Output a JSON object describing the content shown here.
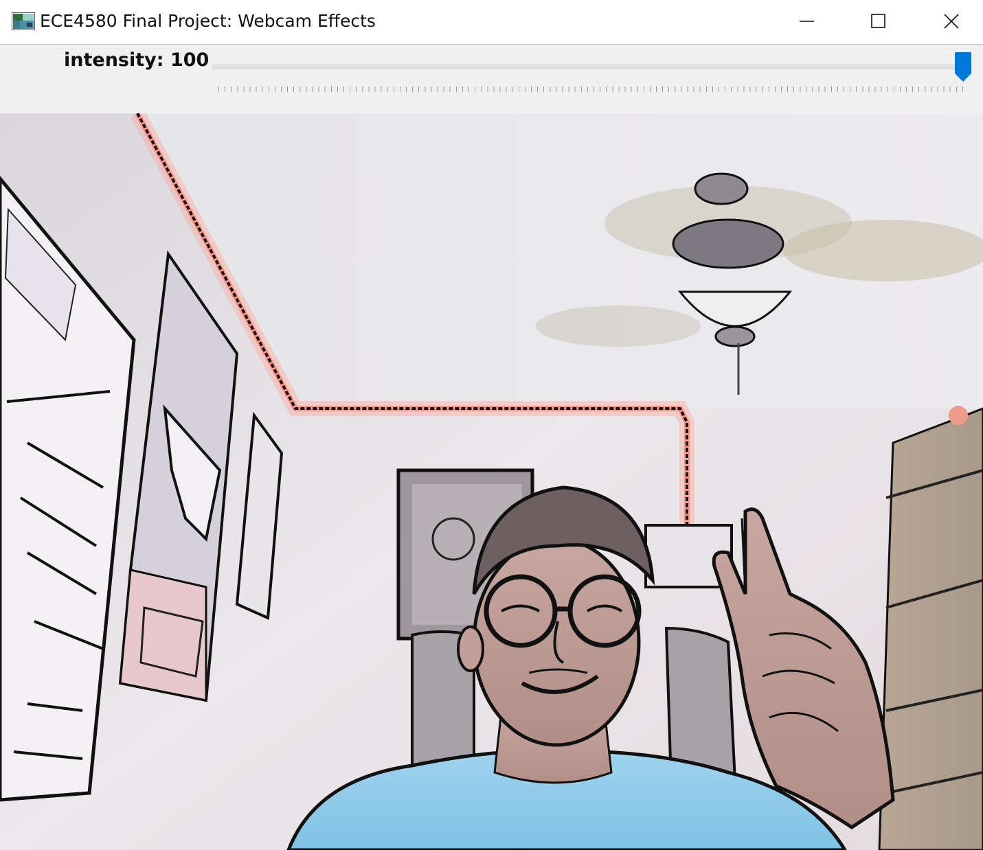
{
  "window": {
    "title": "ECE4580 Final Project: Webcam Effects",
    "icon": "window-app-icon",
    "controls": [
      "minimize-icon",
      "maximize-icon",
      "close-icon"
    ]
  },
  "trackbar": {
    "label": "intensity: 100",
    "value": 100,
    "min": 0,
    "max": 100,
    "thumb_color": "#0078d7"
  },
  "video": {
    "effect": "cartoon edge effect webcam feed",
    "accent_color": "#ff8a7a"
  }
}
